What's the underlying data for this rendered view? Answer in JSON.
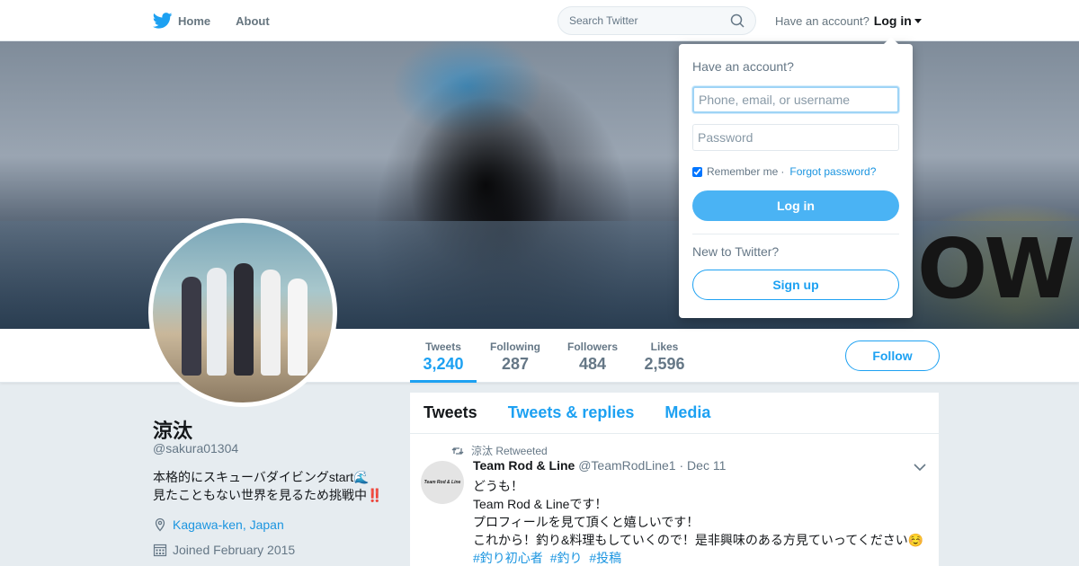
{
  "nav": {
    "home_label": "Home",
    "about_label": "About",
    "search_placeholder": "Search Twitter",
    "have_account_label": "Have an account?",
    "login_label": "Log in"
  },
  "icons": {
    "logo": "twitter-bird-icon",
    "search": "search-icon",
    "location": "location-pin-icon",
    "calendar": "calendar-icon",
    "retweet": "retweet-icon",
    "chevron": "chevron-down-icon"
  },
  "colors": {
    "brand": "#1da1f2",
    "link": "#1b95e0",
    "login_button": "#4ab3f4"
  },
  "banner": {
    "text": "OW"
  },
  "stats": [
    {
      "label": "Tweets",
      "value": "3,240"
    },
    {
      "label": "Following",
      "value": "287"
    },
    {
      "label": "Followers",
      "value": "484"
    },
    {
      "label": "Likes",
      "value": "2,596"
    }
  ],
  "follow_label": "Follow",
  "profile": {
    "name": "涼汰",
    "handle": "@sakura01304",
    "bio_line1": "本格的にスキューバダイビングstart🌊",
    "bio_line2": "見たこともない世界を見るため挑戦中‼️",
    "location": "Kagawa-ken, Japan",
    "joined": "Joined February 2015"
  },
  "timeline": {
    "tabs": [
      "Tweets",
      "Tweets & replies",
      "Media"
    ],
    "tweet": {
      "retweeted_by": "涼汰 Retweeted",
      "avatar_text": "Team Rod & Line",
      "author_name": "Team Rod & Line",
      "author_handle": "@TeamRodLine1",
      "separator": "·",
      "date": "Dec 11",
      "lines": [
        "どうも！",
        "Team Rod & Lineです！",
        "プロフィールを見て頂くと嬉しいです！",
        "これから！釣り&料理もしていくので！是非興味のある方見ていってください☺️"
      ],
      "hashtags": [
        "#釣り初心者",
        "#釣り",
        "#投稿"
      ]
    }
  },
  "login_dropdown": {
    "title": "Have an account?",
    "username_placeholder": "Phone, email, or username",
    "password_placeholder": "Password",
    "remember_label": "Remember me",
    "separator": "·",
    "forgot_label": "Forgot password?",
    "login_button": "Log in",
    "new_label": "New to Twitter?",
    "signup_button": "Sign up"
  }
}
